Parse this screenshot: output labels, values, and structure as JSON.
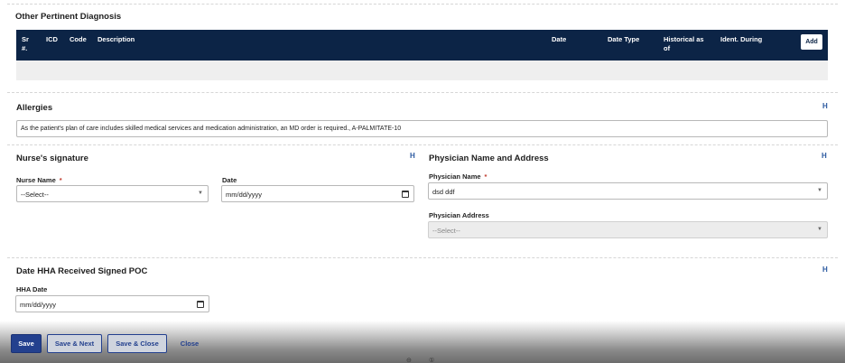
{
  "diagnosis": {
    "title": "Other Pertinent Diagnosis",
    "columns": [
      {
        "l1": "Sr",
        "l2": "#."
      },
      {
        "l1": "ICD",
        "l2": ""
      },
      {
        "l1": "Code",
        "l2": ""
      },
      {
        "l1": "Description",
        "l2": ""
      },
      {
        "l1": "Date",
        "l2": ""
      },
      {
        "l1": "Date Type",
        "l2": ""
      },
      {
        "l1": "Historical as",
        "l2": "of"
      },
      {
        "l1": "Ident. During",
        "l2": ""
      }
    ],
    "add_label": "Add"
  },
  "allergies": {
    "title": "Allergies",
    "h_mark": "H",
    "text": "As the patient's plan of care includes skilled medical services and medication administration, an MD order is required., A-PALMITATE-10"
  },
  "nurse": {
    "title": "Nurse's signature",
    "h_mark": "H",
    "name_label": "Nurse Name",
    "name_required": "*",
    "name_value": "--Select--",
    "date_label": "Date",
    "date_value": "mm/dd/yyyy"
  },
  "physician": {
    "title": "Physician Name and Address",
    "h_mark": "H",
    "name_label": "Physician Name",
    "name_required": "*",
    "name_value": "dsd ddf",
    "address_label": "Physician Address",
    "address_value": "--Select--"
  },
  "hha": {
    "title": "Date HHA Received Signed POC",
    "h_mark": "H",
    "date_label": "HHA Date",
    "date_value": "mm/dd/yyyy"
  },
  "footer": {
    "save": "Save",
    "save_next": "Save & Next",
    "save_close": "Save & Close",
    "close": "Close",
    "pager": [
      "⊝",
      "①"
    ]
  }
}
